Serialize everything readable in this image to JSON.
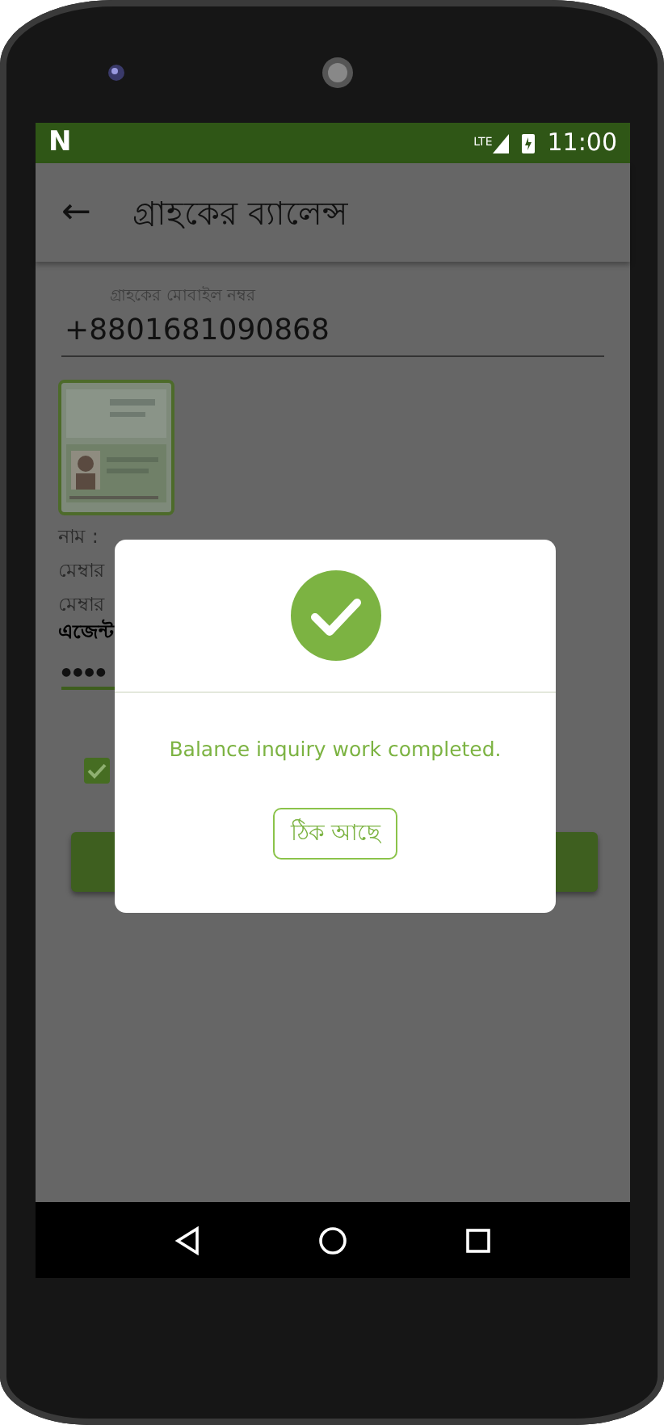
{
  "status_bar": {
    "logo": "N",
    "network": "LTE",
    "time": "11:00"
  },
  "app_bar": {
    "back": "←",
    "title": "গ্রাহকের ব্যালেন্স"
  },
  "form": {
    "mobile_label": "গ্রাহকের মোবাইল নম্বর",
    "mobile_value": "+8801681090868",
    "info_lines": [
      {
        "text": "নাম :",
        "bold": false
      },
      {
        "text": "মেম্বার",
        "bold": false
      },
      {
        "text": "মেম্বার",
        "bold": false
      },
      {
        "text": "এজেন্ট",
        "bold": true
      }
    ],
    "password": "●●●●",
    "agree_checked": true
  },
  "dialog": {
    "message": "Balance inquiry work completed.",
    "button": "ঠিক আছে"
  }
}
